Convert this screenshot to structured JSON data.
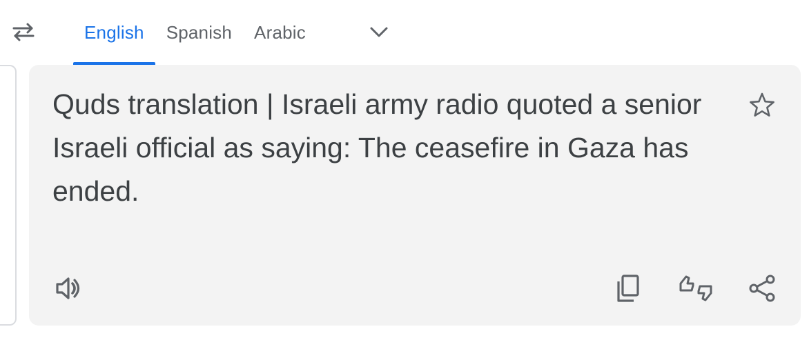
{
  "languages": {
    "tabs": [
      {
        "label": "English",
        "active": true
      },
      {
        "label": "Spanish",
        "active": false
      },
      {
        "label": "Arabic",
        "active": false
      }
    ],
    "swap_icon": "swap-arrows-icon",
    "more_icon": "chevron-down-icon"
  },
  "result": {
    "text": "Quds translation | Israeli army radio quoted a senior Israeli official as saying: The ceasefire in Gaza has ended."
  },
  "actions": {
    "star_icon": "star-outline-icon",
    "listen_icon": "speaker-icon",
    "copy_icon": "copy-icon",
    "feedback_icon": "rate-translation-icon",
    "share_icon": "share-icon"
  },
  "colors": {
    "accent": "#1a73e8",
    "tab_inactive": "#5f6368",
    "text": "#3c4043",
    "panel_background": "#f3f3f3",
    "border": "#dadce0"
  }
}
